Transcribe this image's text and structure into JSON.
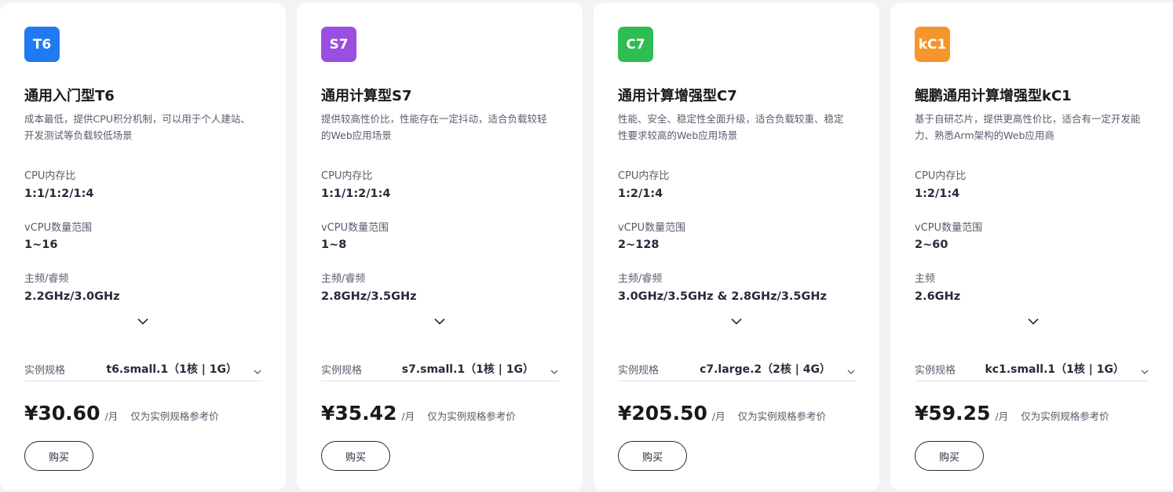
{
  "colors": {
    "t6": "#1e7bf2",
    "s7": "#9a4fe0",
    "c7": "#2dbd52",
    "kc1": "#f5962a"
  },
  "cards": [
    {
      "badge": "T6",
      "title": "通用入门型T6",
      "desc_line1": "成本最低，提供CPU积分机制，可以用于个人建站、",
      "desc_line2": "开发测试等负载较低场景",
      "spec1_label": "CPU内存比",
      "spec1_value": "1:1/1:2/1:4",
      "spec2_label": "vCPU数量范围",
      "spec2_value": "1~16",
      "spec3_label": "主频/睿频",
      "spec3_value": "2.2GHz/3.0GHz",
      "select_label": "实例规格",
      "select_value": "t6.small.1（1核 | 1G）",
      "price": "¥30.60",
      "unit": "/月",
      "note": "仅为实例规格参考价",
      "buy": "购买"
    },
    {
      "badge": "S7",
      "title": "通用计算型S7",
      "desc_line1": "提供较高性价比，性能存在一定抖动，适合负载较轻",
      "desc_line2": "的Web应用场景",
      "spec1_label": "CPU内存比",
      "spec1_value": "1:1/1:2/1:4",
      "spec2_label": "vCPU数量范围",
      "spec2_value": "1~8",
      "spec3_label": "主频/睿频",
      "spec3_value": "2.8GHz/3.5GHz",
      "select_label": "实例规格",
      "select_value": "s7.small.1（1核 | 1G）",
      "price": "¥35.42",
      "unit": "/月",
      "note": "仅为实例规格参考价",
      "buy": "购买"
    },
    {
      "badge": "C7",
      "title": "通用计算增强型C7",
      "desc_line1": "性能、安全、稳定性全面升级，适合负载较重、稳定",
      "desc_line2": "性要求较高的Web应用场景",
      "spec1_label": "CPU内存比",
      "spec1_value": "1:2/1:4",
      "spec2_label": "vCPU数量范围",
      "spec2_value": "2~128",
      "spec3_label": "主频/睿频",
      "spec3_value": "3.0GHz/3.5GHz & 2.8GHz/3.5GHz",
      "select_label": "实例规格",
      "select_value": "c7.large.2（2核 | 4G）",
      "price": "¥205.50",
      "unit": "/月",
      "note": "仅为实例规格参考价",
      "buy": "购买"
    },
    {
      "badge": "kC1",
      "title": "鲲鹏通用计算增强型kC1",
      "desc_line1": "基于自研芯片，提供更高性价比，适合有一定开发能",
      "desc_line2": "力、熟悉Arm架构的Web应用商",
      "spec1_label": "CPU内存比",
      "spec1_value": "1:2/1:4",
      "spec2_label": "vCPU数量范围",
      "spec2_value": "2~60",
      "spec3_label": "主频",
      "spec3_value": "2.6GHz",
      "select_label": "实例规格",
      "select_value": "kc1.small.1（1核 | 1G）",
      "price": "¥59.25",
      "unit": "/月",
      "note": "仅为实例规格参考价",
      "buy": "购买"
    }
  ]
}
